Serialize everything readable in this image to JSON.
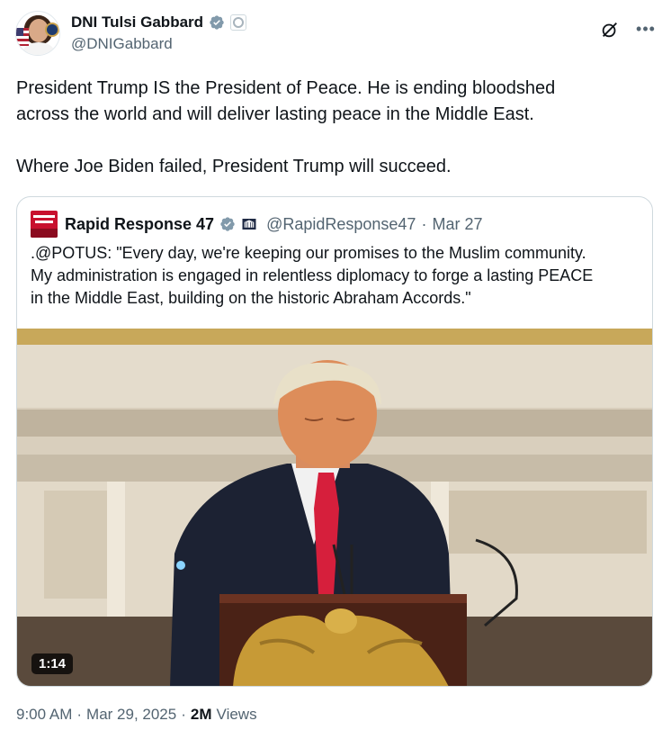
{
  "author": {
    "display_name": "DNI Tulsi Gabbard",
    "handle": "@DNIGabbard"
  },
  "tweet": {
    "text": "President Trump IS the President of Peace. He is ending bloodshed\nacross the world and will deliver lasting peace in the Middle East.\n\nWhere Joe Biden failed, President Trump will succeed."
  },
  "quote": {
    "display_name": "Rapid Response 47",
    "handle": "@RapidResponse47",
    "separator": "·",
    "date": "Mar 27",
    "text": ".@POTUS: \"Every day, we're keeping our promises to the Muslim community.\nMy administration is engaged in relentless diplomacy to forge a lasting PEACE\nin the Middle East, building on the historic Abraham Accords.\"",
    "video_duration": "1:14"
  },
  "footer": {
    "time": "9:00 AM",
    "sep1": "·",
    "date": "Mar 29, 2025",
    "sep2": "·",
    "views_count": "2M",
    "views_label": "Views"
  },
  "colors": {
    "verified_blue": "#1d9bf0",
    "verified_gray": "#829aab",
    "text_primary": "#0f1419",
    "text_secondary": "#536471",
    "border": "#cfd9de"
  },
  "icons": {
    "verified": "verified-badge-icon",
    "affiliate": "government-affiliate-icon",
    "grok": "grok-icon",
    "more": "more-options-icon"
  }
}
